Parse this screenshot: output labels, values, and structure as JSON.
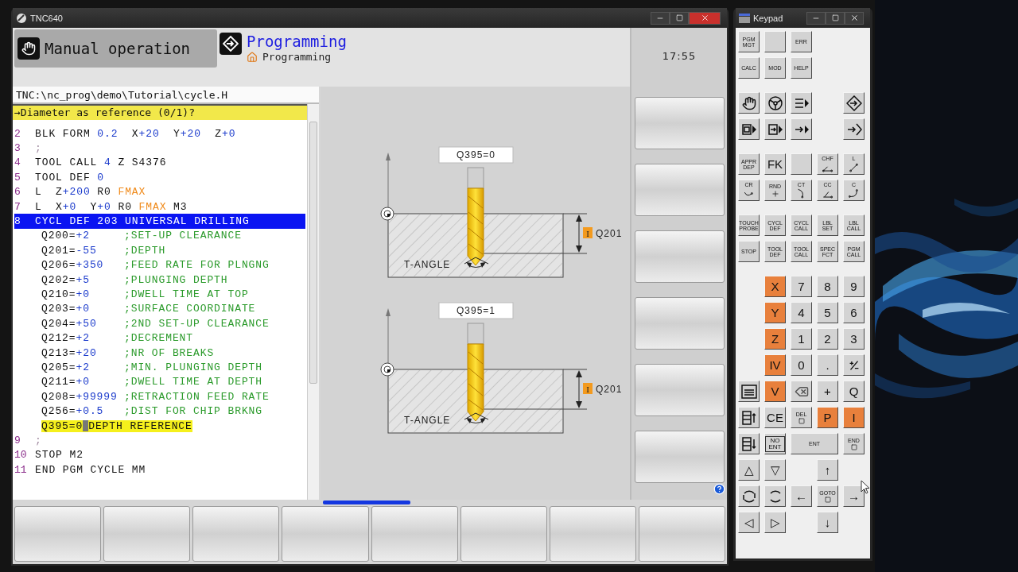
{
  "window": {
    "title": "TNC640"
  },
  "mode_tabs": [
    {
      "label": "Manual operation",
      "selected": false
    },
    {
      "label": "Programming",
      "selected": true,
      "breadcrumb": "Programming"
    }
  ],
  "clock": "17:55",
  "program": {
    "path": "TNC:\\nc_prog\\demo\\Tutorial\\cycle.H",
    "prompt": "→Diameter as reference (0/1)?",
    "lines": [
      {
        "number": "2",
        "selected": false,
        "segments": [
          {
            "text": "BLK FORM ",
            "kind": "word"
          },
          {
            "text": "0.2",
            "kind": "number"
          },
          {
            "text": "  X",
            "kind": "word"
          },
          {
            "text": "+20",
            "kind": "number"
          },
          {
            "text": "  Y",
            "kind": "word"
          },
          {
            "text": "+20",
            "kind": "number"
          },
          {
            "text": "  Z",
            "kind": "word"
          },
          {
            "text": "+0",
            "kind": "number"
          }
        ]
      },
      {
        "number": "3",
        "selected": false,
        "segments": [
          {
            "text": ";",
            "kind": "dim"
          }
        ]
      },
      {
        "number": "4",
        "selected": false,
        "segments": [
          {
            "text": "TOOL CALL ",
            "kind": "word"
          },
          {
            "text": "4",
            "kind": "number"
          },
          {
            "text": " Z S4376",
            "kind": "word"
          }
        ]
      },
      {
        "number": "5",
        "selected": false,
        "segments": [
          {
            "text": "TOOL DEF ",
            "kind": "word"
          },
          {
            "text": "0",
            "kind": "number"
          }
        ]
      },
      {
        "number": "6",
        "selected": false,
        "segments": [
          {
            "text": "L  Z",
            "kind": "word"
          },
          {
            "text": "+200",
            "kind": "number"
          },
          {
            "text": " R0 ",
            "kind": "word"
          },
          {
            "text": "FMAX",
            "kind": "feed"
          }
        ]
      },
      {
        "number": "7",
        "selected": false,
        "segments": [
          {
            "text": "L  X",
            "kind": "word"
          },
          {
            "text": "+0",
            "kind": "number"
          },
          {
            "text": "  Y",
            "kind": "word"
          },
          {
            "text": "+0",
            "kind": "number"
          },
          {
            "text": " R0 ",
            "kind": "word"
          },
          {
            "text": "FMAX",
            "kind": "feed"
          },
          {
            "text": " M3",
            "kind": "word"
          }
        ]
      },
      {
        "number": "8",
        "selected": true,
        "segments": [
          {
            "text": "CYCL DEF 203 UNIVERSAL DRILLING",
            "kind": "word"
          }
        ],
        "children": [
          {
            "param": "Q200=",
            "value": "+2",
            "comment": ";SET-UP CLEARANCE",
            "editing": false
          },
          {
            "param": "Q201=",
            "value": "-55",
            "comment": ";DEPTH",
            "editing": false
          },
          {
            "param": "Q206=",
            "value": "+350",
            "comment": ";FEED RATE FOR PLNGNG",
            "editing": false
          },
          {
            "param": "Q202=",
            "value": "+5",
            "comment": ";PLUNGING DEPTH",
            "editing": false
          },
          {
            "param": "Q210=",
            "value": "+0",
            "comment": ";DWELL TIME AT TOP",
            "editing": false
          },
          {
            "param": "Q203=",
            "value": "+0",
            "comment": ";SURFACE COORDINATE",
            "editing": false
          },
          {
            "param": "Q204=",
            "value": "+50",
            "comment": ";2ND SET-UP CLEARANCE",
            "editing": false
          },
          {
            "param": "Q212=",
            "value": "+2",
            "comment": ";DECREMENT",
            "editing": false
          },
          {
            "param": "Q213=",
            "value": "+20",
            "comment": ";NR OF BREAKS",
            "editing": false
          },
          {
            "param": "Q205=",
            "value": "+2",
            "comment": ";MIN. PLUNGING DEPTH",
            "editing": false
          },
          {
            "param": "Q211=",
            "value": "+0",
            "comment": ";DWELL TIME AT DEPTH",
            "editing": false
          },
          {
            "param": "Q208=",
            "value": "+99999",
            "comment": ";RETRACTION FEED RATE",
            "editing": false
          },
          {
            "param": "Q256=",
            "value": "+0.5",
            "comment": ";DIST FOR CHIP BRKNG",
            "editing": false
          },
          {
            "param": "Q395=",
            "value": "0",
            "comment": "DEPTH REFERENCE",
            "editing": true
          }
        ]
      },
      {
        "number": "9",
        "selected": false,
        "segments": [
          {
            "text": ";",
            "kind": "dim"
          }
        ]
      },
      {
        "number": "10",
        "selected": false,
        "segments": [
          {
            "text": "STOP M2",
            "kind": "word"
          }
        ]
      },
      {
        "number": "11",
        "selected": false,
        "segments": [
          {
            "text": "END PGM CYCLE MM",
            "kind": "word"
          }
        ]
      }
    ]
  },
  "graphic": {
    "figures": [
      {
        "caption": "Q395=0",
        "badge": "I",
        "depth_label": "Q201",
        "angle_label": "T-ANGLE"
      },
      {
        "caption": "Q395=1",
        "badge": "I",
        "depth_label": "Q201",
        "angle_label": "T-ANGLE"
      }
    ]
  },
  "keypad": {
    "title": "Keypad",
    "sections": [
      {
        "keys": [
          {
            "kind": "text",
            "label": "PGM MGT"
          },
          {
            "kind": "blank"
          },
          {
            "kind": "text",
            "label": "ERR"
          },
          {
            "kind": "gap"
          },
          {
            "kind": "gap"
          },
          {
            "kind": "text",
            "label": "CALC"
          },
          {
            "kind": "text",
            "label": "MOD"
          },
          {
            "kind": "text",
            "label": "HELP"
          },
          {
            "kind": "gap"
          },
          {
            "kind": "gap"
          }
        ]
      },
      {
        "keys": [
          {
            "kind": "icon"
          },
          {
            "kind": "icon"
          },
          {
            "kind": "icon"
          },
          {
            "kind": "gap"
          },
          {
            "kind": "icon"
          },
          {
            "kind": "icon"
          },
          {
            "kind": "icon"
          },
          {
            "kind": "icon"
          },
          {
            "kind": "gap"
          },
          {
            "kind": "icon"
          }
        ]
      },
      {
        "keys": [
          {
            "kind": "text",
            "label": "APPR DEP"
          },
          {
            "kind": "big",
            "label": "FK"
          },
          {
            "kind": "blank"
          },
          {
            "kind": "contour",
            "label": "CHF"
          },
          {
            "kind": "contour",
            "label": "L"
          },
          {
            "kind": "contour",
            "label": "CR"
          },
          {
            "kind": "contour",
            "label": "RND"
          },
          {
            "kind": "contour",
            "label": "CT"
          },
          {
            "kind": "contour",
            "label": "CC"
          },
          {
            "kind": "contour",
            "label": "C"
          }
        ]
      },
      {
        "keys": [
          {
            "kind": "text",
            "label": "TOUCH PROBE"
          },
          {
            "kind": "text",
            "label": "CYCL DEF"
          },
          {
            "kind": "text",
            "label": "CYCL CALL"
          },
          {
            "kind": "text",
            "label": "LBL SET"
          },
          {
            "kind": "text",
            "label": "LBL CALL"
          },
          {
            "kind": "text",
            "label": "STOP"
          },
          {
            "kind": "text",
            "label": "TOOL DEF"
          },
          {
            "kind": "text",
            "label": "TOOL CALL"
          },
          {
            "kind": "text",
            "label": "SPEC FCT"
          },
          {
            "kind": "text",
            "label": "PGM CALL"
          }
        ]
      },
      {
        "keys": [
          {
            "kind": "gap"
          },
          {
            "kind": "axis",
            "label": "X"
          },
          {
            "kind": "big",
            "label": "7"
          },
          {
            "kind": "big",
            "label": "8"
          },
          {
            "kind": "big",
            "label": "9"
          },
          {
            "kind": "gap"
          },
          {
            "kind": "axis",
            "label": "Y"
          },
          {
            "kind": "big",
            "label": "4"
          },
          {
            "kind": "big",
            "label": "5"
          },
          {
            "kind": "big",
            "label": "6"
          },
          {
            "kind": "gap"
          },
          {
            "kind": "axis",
            "label": "Z"
          },
          {
            "kind": "big",
            "label": "1"
          },
          {
            "kind": "big",
            "label": "2"
          },
          {
            "kind": "big",
            "label": "3"
          },
          {
            "kind": "gap"
          },
          {
            "kind": "axis",
            "label": "IV"
          },
          {
            "kind": "big",
            "label": "0"
          },
          {
            "kind": "big",
            "label": "."
          },
          {
            "kind": "icon"
          },
          {
            "kind": "icon"
          },
          {
            "kind": "axis",
            "label": "V"
          },
          {
            "kind": "icon"
          },
          {
            "kind": "big",
            "label": "+"
          },
          {
            "kind": "big",
            "label": "Q"
          },
          {
            "kind": "icon"
          },
          {
            "kind": "big",
            "label": "CE"
          },
          {
            "kind": "boxed",
            "label": "DEL"
          },
          {
            "kind": "axis",
            "label": "P"
          },
          {
            "kind": "axis",
            "label": "I"
          },
          {
            "kind": "icon"
          },
          {
            "kind": "framed",
            "label": "NO ENT"
          },
          {
            "kind": "wide",
            "label": "ENT"
          },
          {
            "kind": "boxed",
            "label": "END"
          },
          {
            "kind": "big",
            "label": "△"
          },
          {
            "kind": "big",
            "label": "▽"
          },
          {
            "kind": "gap"
          },
          {
            "kind": "big",
            "label": "↑"
          },
          {
            "kind": "gap"
          },
          {
            "kind": "icon"
          },
          {
            "kind": "icon"
          },
          {
            "kind": "big",
            "label": "←"
          },
          {
            "kind": "boxed",
            "label": "GOTO"
          },
          {
            "kind": "big",
            "label": "→"
          },
          {
            "kind": "big",
            "label": "◁"
          },
          {
            "kind": "big",
            "label": "▷"
          },
          {
            "kind": "gap"
          },
          {
            "kind": "big",
            "label": "↓"
          },
          {
            "kind": "gap"
          }
        ]
      }
    ]
  }
}
